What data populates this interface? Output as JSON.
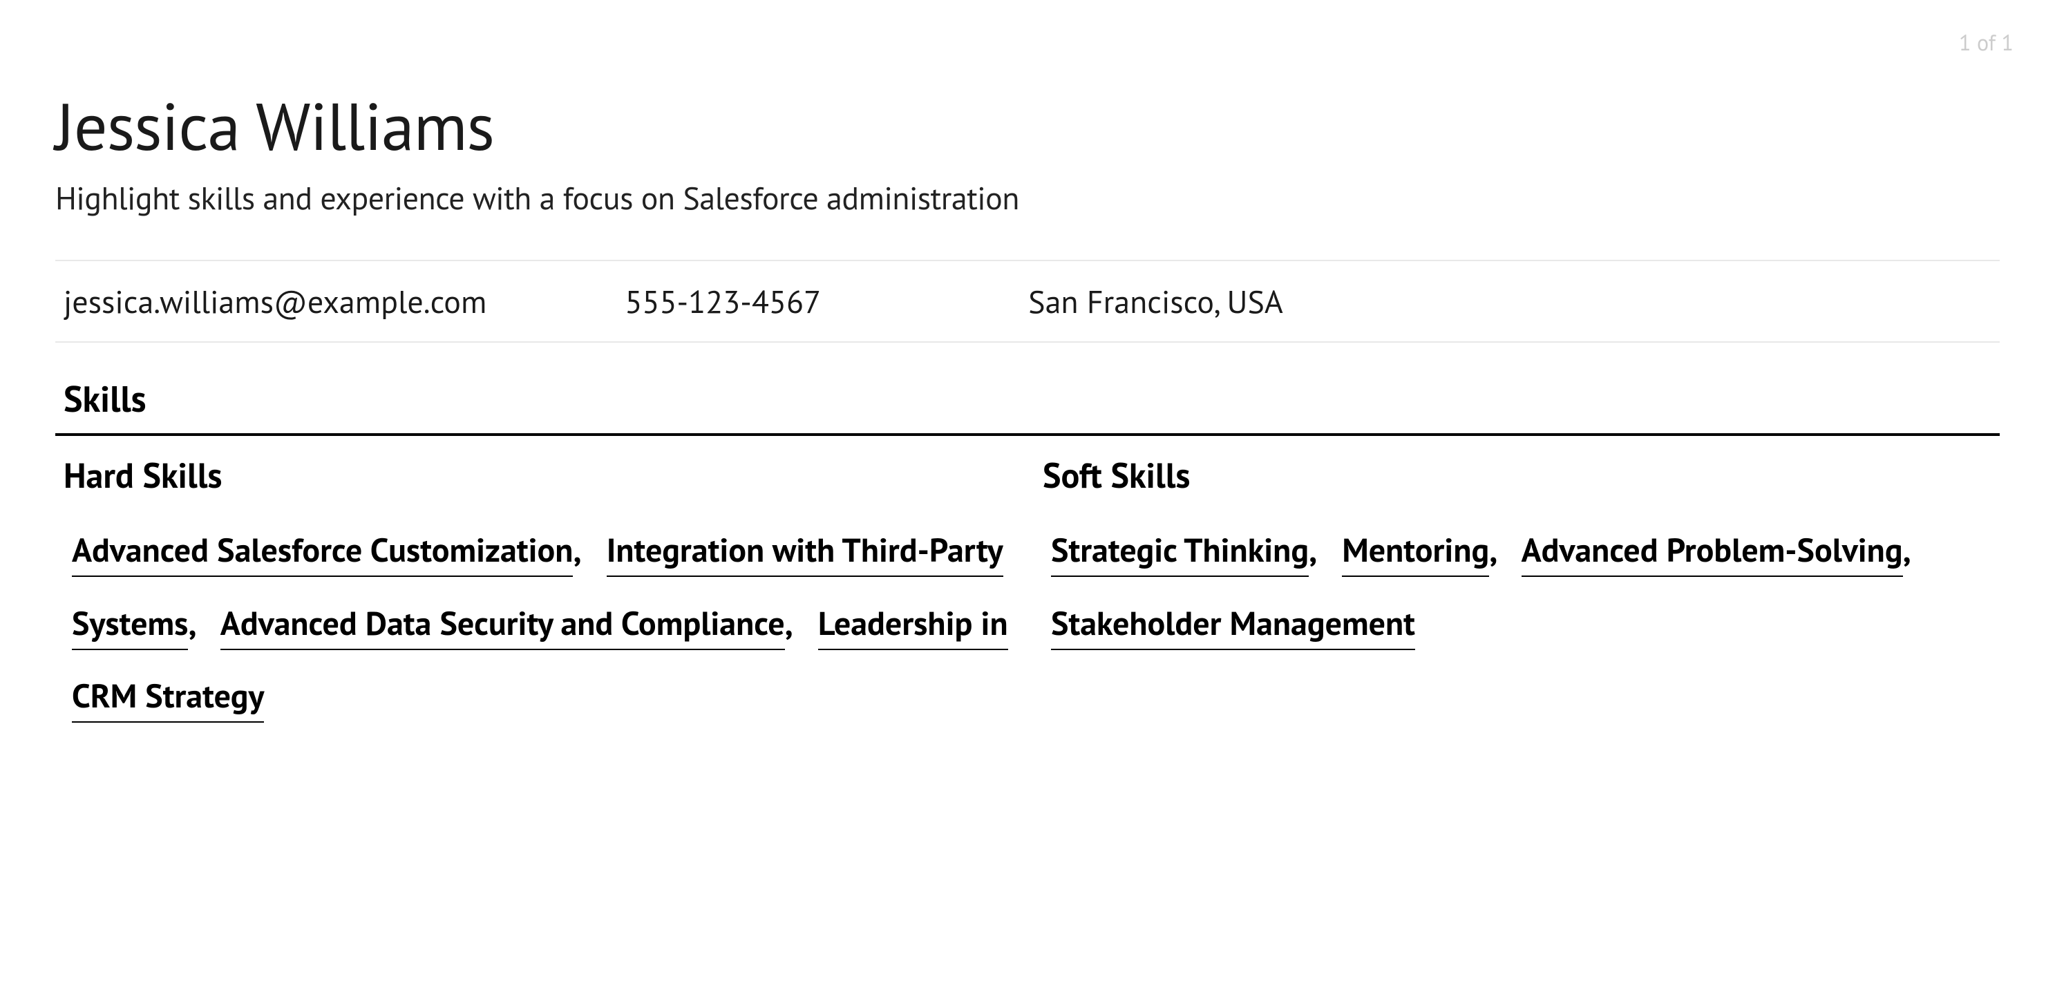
{
  "page_counter": "1 of 1",
  "header": {
    "name": "Jessica Williams",
    "tagline": "Highlight skills and experience with a focus on Salesforce administration"
  },
  "contact": {
    "email": "jessica.williams@example.com",
    "phone": "555-123-4567",
    "location": "San Francisco, USA"
  },
  "sections": {
    "skills": {
      "title": "Skills",
      "hard": {
        "title": "Hard Skills",
        "items": [
          "Advanced Salesforce Customization",
          "Integration with Third-Party Systems",
          "Advanced Data Security and Compliance",
          "Leadership in CRM Strategy"
        ]
      },
      "soft": {
        "title": "Soft Skills",
        "items": [
          "Strategic Thinking",
          "Mentoring",
          "Advanced Problem-Solving",
          "Stakeholder Management"
        ]
      }
    }
  }
}
